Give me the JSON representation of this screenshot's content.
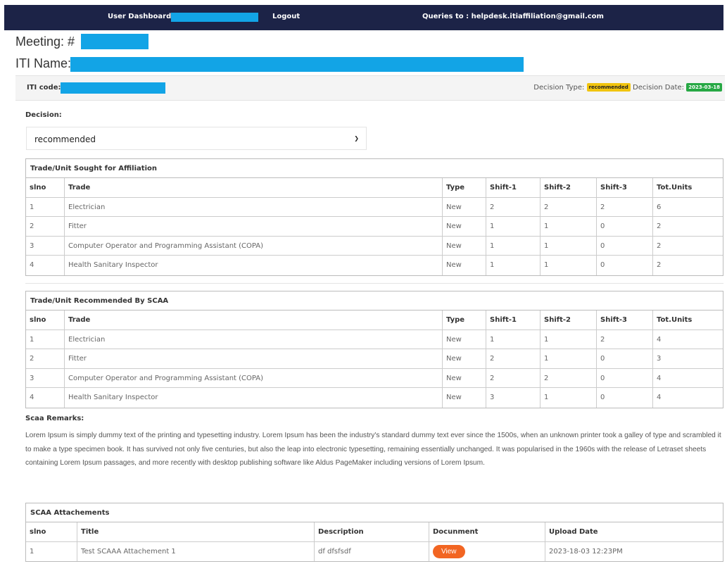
{
  "nav": {
    "dashboard": "User Dashboard",
    "logout": "Logout",
    "queries": "Queries to : helpdesk.itiaffiliation@gmail.com"
  },
  "meeting_label": "Meeting: #",
  "iti_name_label": "ITI Name:",
  "iti_code_label": "ITI code:",
  "decision_type_label": "Decision Type:",
  "decision_type_value": "recommended",
  "decision_date_label": "Decision Date:",
  "decision_date_value": "2023-03-18",
  "decision_label": "Decision:",
  "decision_select_value": "recommended",
  "columns": [
    "slno",
    "Trade",
    "Type",
    "Shift-1",
    "Shift-2",
    "Shift-3",
    "Tot.Units"
  ],
  "sought": {
    "title": "Trade/Unit Sought for Affiliation",
    "rows": [
      [
        "1",
        "Electrician",
        "New",
        "2",
        "2",
        "2",
        "6"
      ],
      [
        "2",
        "Fitter",
        "New",
        "1",
        "1",
        "0",
        "2"
      ],
      [
        "3",
        "Computer Operator and Programming Assistant (COPA)",
        "New",
        "1",
        "1",
        "0",
        "2"
      ],
      [
        "4",
        "Health Sanitary Inspector",
        "New",
        "1",
        "1",
        "0",
        "2"
      ]
    ]
  },
  "recommended": {
    "title": "Trade/Unit Recommended By SCAA",
    "rows": [
      [
        "1",
        "Electrician",
        "New",
        "1",
        "1",
        "2",
        "4"
      ],
      [
        "2",
        "Fitter",
        "New",
        "2",
        "1",
        "0",
        "3"
      ],
      [
        "3",
        "Computer Operator and Programming Assistant (COPA)",
        "New",
        "2",
        "2",
        "0",
        "4"
      ],
      [
        "4",
        "Health Sanitary Inspector",
        "New",
        "3",
        "1",
        "0",
        "4"
      ]
    ]
  },
  "remarks_label": "Scaa Remarks:",
  "remarks_text": "Lorem Ipsum is simply dummy text of the printing and typesetting industry. Lorem Ipsum has been the industry's standard dummy text ever since the 1500s, when an unknown printer took a galley of type and scrambled it to make a type specimen book. It has survived not only five centuries, but also the leap into electronic typesetting, remaining essentially unchanged. It was popularised in the 1960s with the release of Letraset sheets containing Lorem Ipsum passages, and more recently with desktop publishing software like Aldus PageMaker including versions of Lorem Ipsum.",
  "attachments": {
    "title": "SCAA Attachements",
    "columns": [
      "slno",
      "Title",
      "Description",
      "Docunment",
      "Upload Date"
    ],
    "rows": [
      {
        "slno": "1",
        "title": "Test SCAAA Attachement 1",
        "description": "df dfsfsdf",
        "button": "View",
        "date": "2023-18-03 12:23PM"
      }
    ]
  },
  "colors": {
    "nav_bg": "#1c2347",
    "redaction": "#12a4e6",
    "badge_recommended": "#f1c40f",
    "badge_date": "#27a844",
    "view_button": "#f26522"
  }
}
